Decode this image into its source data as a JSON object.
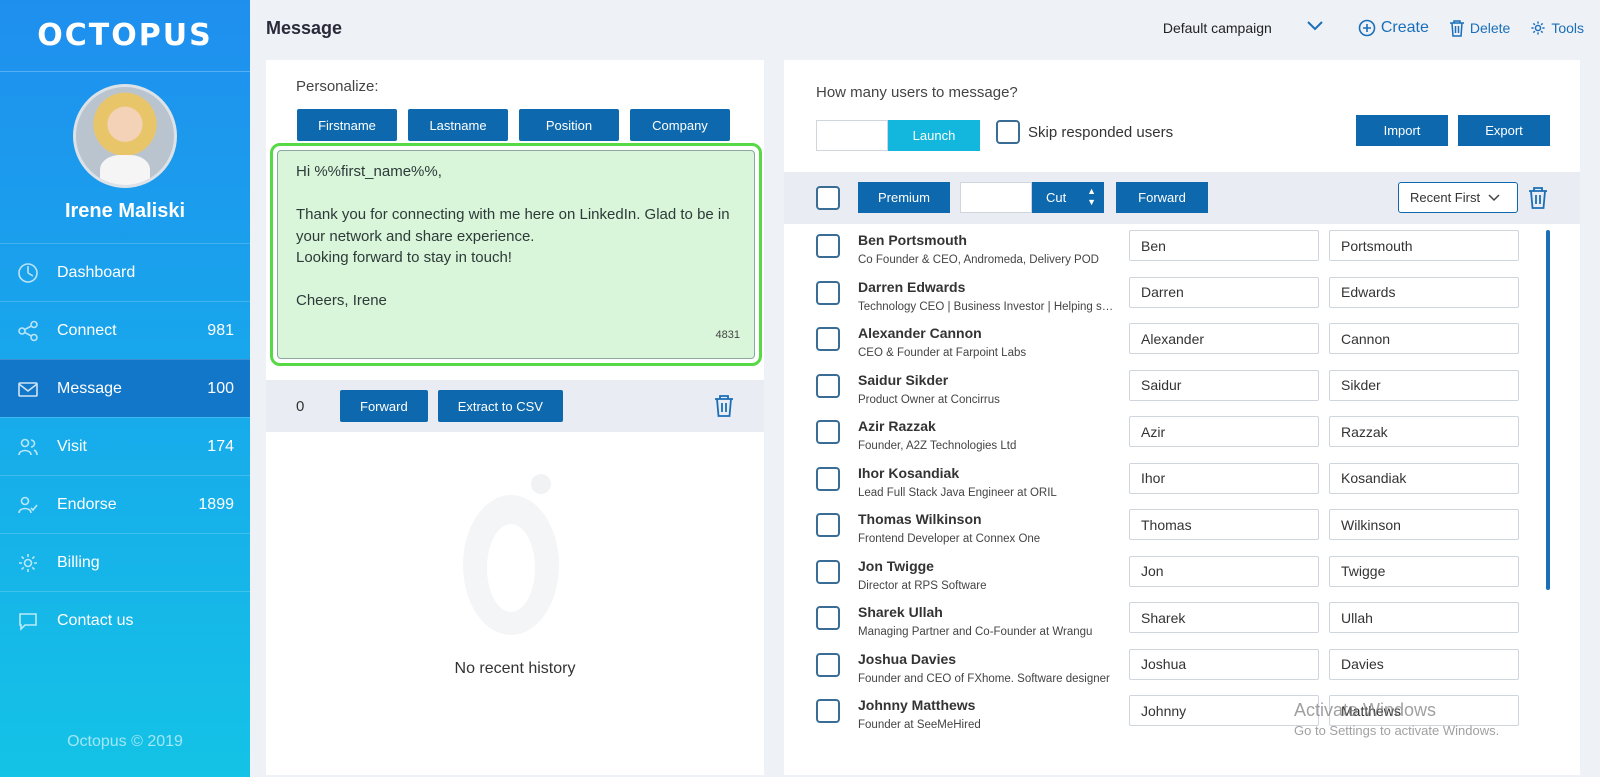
{
  "sidebar": {
    "logo": "OCTOPUS",
    "user_name": "Irene Maliski",
    "nav": [
      {
        "label": "Dashboard",
        "count": "",
        "icon": "dashboard-icon"
      },
      {
        "label": "Connect",
        "count": "981",
        "icon": "share-icon"
      },
      {
        "label": "Message",
        "count": "100",
        "icon": "mail-icon"
      },
      {
        "label": "Visit",
        "count": "174",
        "icon": "users-icon"
      },
      {
        "label": "Endorse",
        "count": "1899",
        "icon": "user-check-icon"
      },
      {
        "label": "Billing",
        "count": "",
        "icon": "gear-icon"
      },
      {
        "label": "Contact us",
        "count": "",
        "icon": "chat-icon"
      }
    ],
    "copyright": "Octopus © 2019"
  },
  "header": {
    "title": "Message",
    "campaign": "Default campaign",
    "create": "Create",
    "delete": "Delete",
    "tools": "Tools"
  },
  "left": {
    "personalize_label": "Personalize:",
    "buttons": [
      "Firstname",
      "Lastname",
      "Position",
      "Company"
    ],
    "message": "Hi %%first_name%%,\n\nThank you for connecting with me here on LinkedIn. Glad to be in your network and share experience.\nLooking forward to stay in touch!\n\nCheers, Irene",
    "char_count": "4831",
    "selected_count": "0",
    "forward": "Forward",
    "extract": "Extract to CSV",
    "empty_text": "No recent history"
  },
  "right": {
    "question": "How many users to message?",
    "launch": "Launch",
    "skip": "Skip responded users",
    "import": "Import",
    "export": "Export",
    "premium": "Premium",
    "cut": "Cut",
    "forward": "Forward",
    "sort": "Recent First",
    "users": [
      {
        "name": "Ben Portsmouth",
        "title": "Co Founder & CEO, Andromeda, Delivery POD",
        "first": "Ben",
        "last": "Portsmouth"
      },
      {
        "name": "Darren Edwards",
        "title": "Technology CEO | Business Investor | Helping startups",
        "first": "Darren",
        "last": "Edwards"
      },
      {
        "name": "Alexander Cannon",
        "title": "CEO & Founder at Farpoint Labs",
        "first": "Alexander",
        "last": "Cannon"
      },
      {
        "name": "Saidur Sikder",
        "title": "Product Owner at Concirrus",
        "first": "Saidur",
        "last": "Sikder"
      },
      {
        "name": "Azir Razzak",
        "title": "Founder, A2Z Technologies Ltd",
        "first": "Azir",
        "last": "Razzak"
      },
      {
        "name": "Ihor Kosandiak",
        "title": "Lead Full Stack Java Engineer at ORIL",
        "first": "Ihor",
        "last": "Kosandiak"
      },
      {
        "name": "Thomas Wilkinson",
        "title": "Frontend Developer at Connex One",
        "first": "Thomas",
        "last": "Wilkinson"
      },
      {
        "name": "Jon Twigge",
        "title": "Director at RPS Software",
        "first": "Jon",
        "last": "Twigge"
      },
      {
        "name": "Sharek Ullah",
        "title": "Managing Partner and Co-Founder at Wrangu",
        "first": "Sharek",
        "last": "Ullah"
      },
      {
        "name": "Joshua Davies",
        "title": "Founder and CEO of FXhome. Software designer",
        "first": "Joshua",
        "last": "Davies"
      },
      {
        "name": "Johnny Matthews",
        "title": "Founder at SeeMeHired",
        "first": "Johnny",
        "last": "Matthews"
      }
    ]
  },
  "watermark": {
    "line1": "Activate Windows",
    "line2": "Go to Settings to activate Windows."
  }
}
